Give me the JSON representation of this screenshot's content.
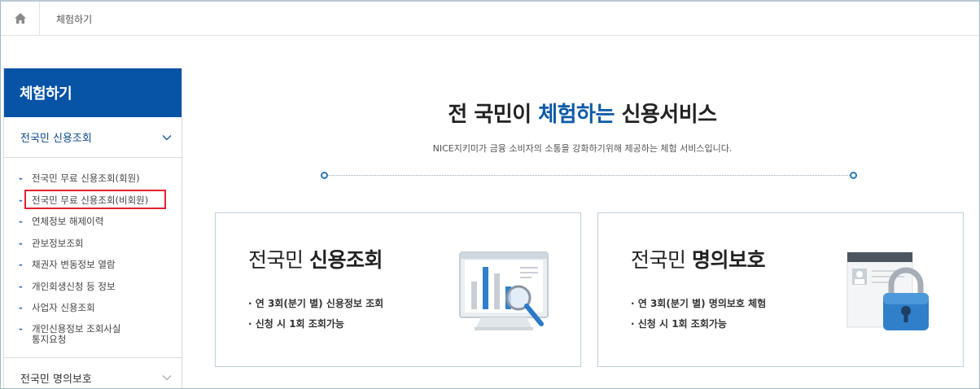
{
  "breadcrumb": {
    "home_icon": "home-icon",
    "current": "체험하기"
  },
  "sidebar": {
    "title": "체험하기",
    "section_open": {
      "label": "전국민 신용조회",
      "icon": "chevron-up-icon"
    },
    "items": [
      {
        "label": "전국민 무료 신용조회(회원)"
      },
      {
        "label": "전국민 무료 신용조회(비회원)"
      },
      {
        "label": "연체정보 해제이력"
      },
      {
        "label": "관보정보조회"
      },
      {
        "label": "채권자 변동정보 열람"
      },
      {
        "label": "개인회생신청 등 정보"
      },
      {
        "label": "사업자 신용조회"
      },
      {
        "label_line1": "개인신용정보 조회사실",
        "label_line2": "통지요청"
      }
    ],
    "section_closed": {
      "label": "전국민 명의보호",
      "icon": "chevron-down-icon"
    }
  },
  "main": {
    "title_part1": "전 국민이 ",
    "title_accent": "체험하는",
    "title_part2": " 신용서비스",
    "subtitle": "NICE지키미가 금융 소비자의 소통을 강화하기위해 제공하는 체험 서비스입니다.",
    "accent_color": "#0e5aa7",
    "cards": [
      {
        "title_light": "전국민 ",
        "title_bold": "신용조회",
        "line1": "· 연 3회(분기 별) 신용정보 조회",
        "line2": "· 신청 시 1회 조회가능",
        "icon": "monitor-chart-magnifier-icon"
      },
      {
        "title_light": "전국민 ",
        "title_bold": "명의보호",
        "line1": "· 연 3회(분기 별) 명의보호 체험",
        "line2": "· 신청 시 1회 조회가능",
        "icon": "id-card-lock-icon"
      }
    ]
  }
}
